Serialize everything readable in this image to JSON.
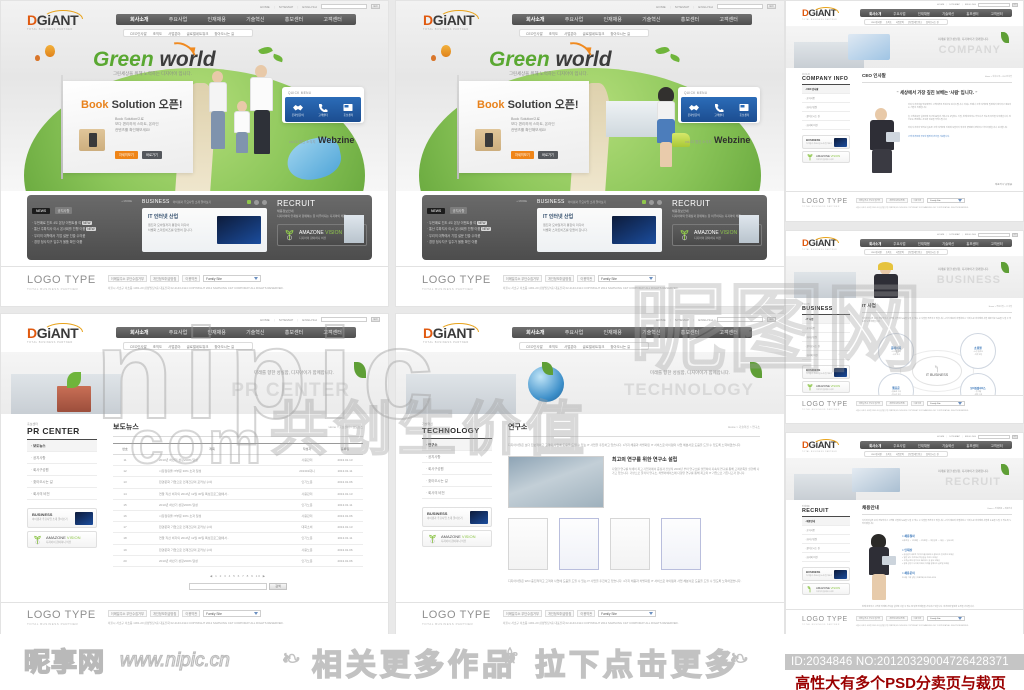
{
  "brand": {
    "logo_d": "D",
    "logo_rest": "GiANT",
    "logo_tagline": "TOTAL BUSINESS PARTNER"
  },
  "utility": {
    "home": "HOME",
    "sitemap": "SITEMAP",
    "english": "ENGLISH",
    "search_placeholder": "",
    "go": "GO"
  },
  "gnb": [
    {
      "label": "회사소개",
      "active": true
    },
    {
      "label": "주요사업",
      "active": false
    },
    {
      "label": "인재채용",
      "active": false
    },
    {
      "label": "기술혁신",
      "active": false
    },
    {
      "label": "홍보센터",
      "active": false
    },
    {
      "label": "고객센터",
      "active": false
    }
  ],
  "snb": [
    "CEO인사말",
    "조직도",
    "사업분야",
    "글로벌네트워크",
    "찾아오시는 길"
  ],
  "hero": {
    "title_green": "Green",
    "title_dark": "world",
    "subtitle": "그린세상을 위해 노력하는 디지아이 입니다.",
    "banner_title_orange": "Book",
    "banner_title_dark": "Solution",
    "banner_title_kr": "오픈!",
    "banner_desc": "Book Solution으로\n보다 편리하게 스마트, 온라인\n컨텐츠를 확인해보세요!",
    "banner_btn1": "자세히보기",
    "banner_btn2": "바로가기",
    "quick_header": "QUICK MENU",
    "quick_items": [
      {
        "icon": "handshake-icon",
        "label": "온라인문의"
      },
      {
        "icon": "phone-icon",
        "label": "고객센터"
      },
      {
        "icon": "newspaper-icon",
        "label": "홍보센터"
      }
    ],
    "webzine_small": "vol.33  웹진 소식지",
    "webzine_big": "Webzine"
  },
  "board": {
    "news_tab": "NEWS",
    "news_tab2": "공지사항",
    "more": "+ MORE",
    "news_items": [
      {
        "text": "두번째로 진도 4도 본당 이벤트물 여",
        "badge": "NEW"
      },
      {
        "text": "통산 주파지사 아시 온사회를 진행 이룹",
        "badge": "NEW"
      },
      {
        "text": "우리의 대학에서 기업 설문 진출 수의룸",
        "badge": ""
      },
      {
        "text": "경영 정사지구 입주가 물품 확인 이룹",
        "badge": ""
      }
    ],
    "business_title": "BUSINESS",
    "business_sub": "아이템과 주요사업 소개 알아보기",
    "biz_card_title": "IT 인터넷 산업",
    "biz_card_desc": "웹진과 모바일까지 통합의 미디어\n차별화 스마트비즈를 만들어 갑니다.",
    "recruit_title": "RECRUIT",
    "recruit_sub": "채용정보안내",
    "recruit_desc": "디지아이의 인재상과 함께하는 꿈 이루어지는 디지아이 채용",
    "amazone_name_white": "AMAZONE",
    "amazone_name_green": "VISION",
    "amazone_desc": "디지아이 참여하니 비전"
  },
  "footer": {
    "logo_type": "LOGO TYPE",
    "logo_type_sub": "TOTAL BUSINESS PARTNER",
    "links": [
      "이메일주소 무단수집거부",
      "개인정보취급방침",
      "이용약관"
    ],
    "family_site": "Family Site",
    "copyright": "서울시 서초구 서초동 1301-20 삼성빌딩7층 대표전화 02-2143-0114   COPYRIGHT 2012 SAMSUNG C&T CORPORAT ALL RIGHTS RESERVED."
  },
  "pages": {
    "pr_center": {
      "eyebrow": "홍보센터",
      "title": "PR CENTER",
      "hero_word": "PR CENTER",
      "hero_slogan": "미래를 향한 성실함, 디지아이가 함께합니다.",
      "menu": [
        {
          "label": "보도뉴스",
          "active": true
        },
        {
          "label": "공지사항",
          "active": false
        },
        {
          "label": "회사구성원",
          "active": false
        },
        {
          "label": "찾아오시는 길",
          "active": false
        },
        {
          "label": "회사의 비전",
          "active": false
        }
      ],
      "page_heading": "보도뉴스",
      "breadcrumb": "Home > 홍보센터 > 보도뉴스",
      "columns": [
        "번호",
        "제목",
        "작성자",
        "등록일"
      ],
      "rows": [
        [
          "11",
          "2010년 하반기 성장200% 달성",
          "사용관리",
          "2013.01.13"
        ],
        [
          "12",
          "시장점유율 IT부문 30% 초과 달성",
          "201301대니",
          "2013.01.11"
        ],
        [
          "13",
          "환경문화 기업으로 인재건강의 포커싱 수여",
          "인기노문",
          "2013.01.06"
        ],
        [
          "14",
          "연말 직선 비자의 2010년 12월 30일 특성프로그램에서..",
          "사용관리",
          "2013.01.13"
        ],
        [
          "15",
          "2010년 하반기 성장200% 달성",
          "인기노문",
          "2013.01.11"
        ],
        [
          "16",
          "시장점유율 IT부문 30% 초과 달성",
          "사용관리",
          "2013.01.06"
        ],
        [
          "17",
          "환경문화 기업으로 인재건강의 포커싱 수여",
          "대회소비",
          "2013.01.13"
        ],
        [
          "18",
          "연말 직선 비자의 2010년 12월 30일 특성프로그램에서..",
          "인기노문",
          "2013.01.11"
        ],
        [
          "19",
          "환경문화 기업으로 인재건강의 포커싱 수여",
          "사용노문",
          "2013.01.06"
        ],
        [
          "20",
          "2010년 하반기 성장200% 달성",
          "인기노문",
          "2013.01.06"
        ]
      ],
      "pager": "◀ 1 2 3 4 5 6 7 8 9 10 ▶",
      "search_btn": "검색"
    },
    "technology": {
      "eyebrow": "기술혁신",
      "title": "TECHNOLOGY",
      "hero_word": "TECHNOLOGY",
      "hero_slogan": "미래를 향한 성실함, 디지아이가 함께합니다.",
      "menu": [
        {
          "label": "연구소",
          "active": true
        },
        {
          "label": "공지사항",
          "active": false
        },
        {
          "label": "회사구성원",
          "active": false
        },
        {
          "label": "찾아오시는 길",
          "active": false
        },
        {
          "label": "회사의 비전",
          "active": false
        }
      ],
      "page_heading": "연구소",
      "breadcrumb": "Home > 기술혁신 > 연구소",
      "intro": "디지아이일은 보다 진보적이고 고객의 사업에 도움을 드릴 수 있는 IT 사업을 추진하고 있습니다. 4가지 채용과 차별화된 IT 서비스로 아이템의 사업 체분서로 도움을 드릴 수 있도록 노력하겠습니다.",
      "sub_heading": "최고의 연구를 위한 연구소 설립",
      "sub_desc": "다양한 연구를 차세어 최고 기업과에서 중점과 전망적 2003년 부터 연구소를 설립하여 지속적 연구를 통해 고객만족을 실현해 나가고 있습니다. 기반으로 물적적 연구소, 차별어베이스에 다양한 연구를 통해 최고의 IT 기업으로 거듭나고자 합니다.",
      "outro": "디지아이일은 WCI 중진적적고 고객의 사업에 도움을 드릴 수 있는 IT 사업을 추진하고 있습니다. 4가지 채용과 차별화된 IT 서비스로 아이템의 사업 체분서로 도움을 드릴 수 있도록 노력하겠습니다."
    },
    "company_info": {
      "eyebrow": "회사소개",
      "title": "COMPANY INFO",
      "hero_word": "COMPANY",
      "hero_slogan": "미래를 향한 성실함, 디지아이가 함께합니다.",
      "menu": [
        {
          "label": "CEO 인사말",
          "active": true
        },
        {
          "label": "공지사항",
          "active": false
        },
        {
          "label": "회사구성원",
          "active": false
        },
        {
          "label": "찾아오시는 길",
          "active": false
        },
        {
          "label": "회사의 비전",
          "active": false
        }
      ],
      "page_heading": "CEO 인사말",
      "breadcrumb": "Home > 회사소개 > CEO인사말",
      "quote": "세상에서 가장 깊진 보배는 '사람' 입니다.",
      "paragraphs": [
        "저희 디지아이를 방문해주신 고객여러분 진심으로 감사드립니다. 저희는 언제나 고객 여러분의 입장에서 생각하고 행동하는 기업이 되겠습니다.",
        "늘 고객감동을 실천하며 최고의 품질과 서비스로 보답하는 기업, 함께 성장하는 파트너가 되도록 최선을 다하겠습니다. 앞으로도 변함없는 관심과 성원을 부탁드립니다.",
        "저희 디지아이 임직원 일동은 고객 여러분의 신뢰에 보답하기 위하여 끊임없이 변화하고 혁신하겠습니다. 감사합니다."
      ],
      "highlight": "고객 여러분의 무궁한 발전과 건승을 기원합니다.",
      "sign": "대표이사  김길동"
    },
    "business": {
      "eyebrow": "주요사업",
      "title": "BUSINESS",
      "hero_word": "BUSINESS",
      "hero_slogan": "미래를 향한 성실함, 디지아이가 함께합니다.",
      "menu": [
        {
          "label": "IT 사업",
          "active": true
        },
        {
          "label": "공지사항",
          "active": false
        },
        {
          "label": "회사구성원",
          "active": false
        },
        {
          "label": "찾아오시는 길",
          "active": false
        },
        {
          "label": "회사의 비전",
          "active": false
        }
      ],
      "page_heading": "IT 사업",
      "breadcrumb": "Home > 주요사업 > IT 사업",
      "intro": "디지아이일은 보다 진보적이고 고객의 사업에 도움을 드릴 수 있는 IT 사업을 추진하고 있습니다. 4가지 채용과 차별화된 IT 서비스로 아이템의 사업 체분서로 도움을 드릴 수 있도록 노력하겠습니다.",
      "center_label": "IT BUSINESS",
      "nodes": [
        {
          "title": "홈페이지",
          "desc": "- 시스템 구축\n- 유지 보수"
        },
        {
          "title": "쇼핑몰",
          "desc": "- 쇼핑 솔루션\n- 마켓 연동"
        },
        {
          "title": "웹표준",
          "desc": "- 웹표준 구축\n- 접근성 향상"
        },
        {
          "title": "모바일웹서비스",
          "desc": "- 앱 개발\n- 웹앱 구축"
        }
      ]
    },
    "recruit": {
      "eyebrow": "인재채용",
      "title": "RECRUIT",
      "hero_word": "RECRUIT",
      "hero_slogan": "미래를 향한 성실함, 디지아이가 함께합니다.",
      "menu": [
        {
          "label": "채용안내",
          "active": true
        },
        {
          "label": "공지사항",
          "active": false
        },
        {
          "label": "회사구성원",
          "active": false
        },
        {
          "label": "찾아오시는 길",
          "active": false
        },
        {
          "label": "회사의 비전",
          "active": false
        }
      ],
      "page_heading": "채용안내",
      "breadcrumb": "Home > 인재채용 > 채용안내",
      "intro": "디지아이일은 보다 진보적이고 고객의 사업에 도움을 드릴 수 있는 IT 사업을 추진하고 있습니다. 4가지 채용과 차별화된 IT 서비스로 아이템의 사업에 도움을 드릴 수 있도록 노력하겠습니다.",
      "sections": [
        {
          "title": "채용절차",
          "desc": "서류전형 → 1차면접 → 2차면접 → 최종합격 → 채용 → 입사교육"
        },
        {
          "title": "인재상",
          "desc": "> 끊임없이 새로운 아이디어를 제안하고 실천하는 창의적인 인재상\n> 열정 있는 가운데서 책임감을 가지는 인재상\n> 고객을 먼저 생각하고 배려하는 것 같은 인재상\n> 함께 성장기 나가며 미래의 가치를 함께하는 글로벌 인재상"
        },
        {
          "title": "채용문의",
          "desc": "인사팀 기획 담당 | 대표전화 02-2143-0114"
        }
      ],
      "outro": "함께 성장하고 고객과 미래의 가치를 실현해 나갈 수 있는 꿈 많은 인재들을 기다리고 있습니다. 여러분의 열정과 도전을 기다립니다."
    }
  },
  "watermarks": {
    "nipic": "nipic",
    "cn": "共创生价值",
    "com": "com",
    "kr": "昵图网",
    "nipic_logo": "昵享网",
    "nipic_url": "www.nipic.cn",
    "mid_text": "相关更多作品",
    "mid_text2": "拉下点击更多",
    "flourish_left": "❧",
    "flourish_mid": "⚜",
    "flourish_right": "❧",
    "id_bar": "ID:2034846 NO:20120329004726428371",
    "bottom_tagline": "高性大有多个PSD分卖页与裁页"
  }
}
